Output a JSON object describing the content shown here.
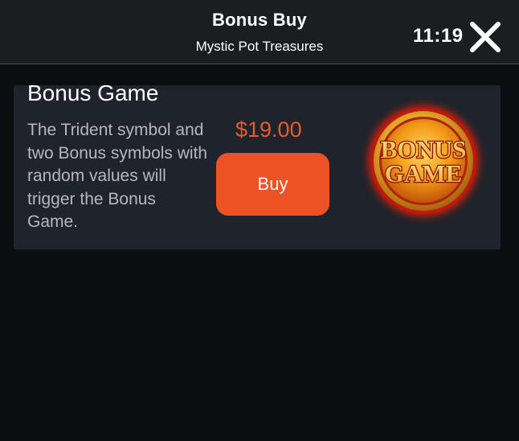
{
  "header": {
    "title": "Bonus Buy",
    "subtitle": "Mystic Pot Treasures",
    "clock": "11:19",
    "close_icon": "close-icon"
  },
  "offer": {
    "title": "Bonus Game",
    "description": "The Trident symbol and two Bonus symbols with random values will trigger the Bonus Game.",
    "price": "$19.00",
    "buy_label": "Buy",
    "badge_line1": "BONUS",
    "badge_line2": "GAME",
    "badge_icon": "bonus-game-badge-icon"
  },
  "colors": {
    "accent": "#ec5224",
    "price": "#ec5a2b",
    "background": "#0c0d10",
    "header_bg": "#1c1d20",
    "card_bg": "#1f232b"
  }
}
